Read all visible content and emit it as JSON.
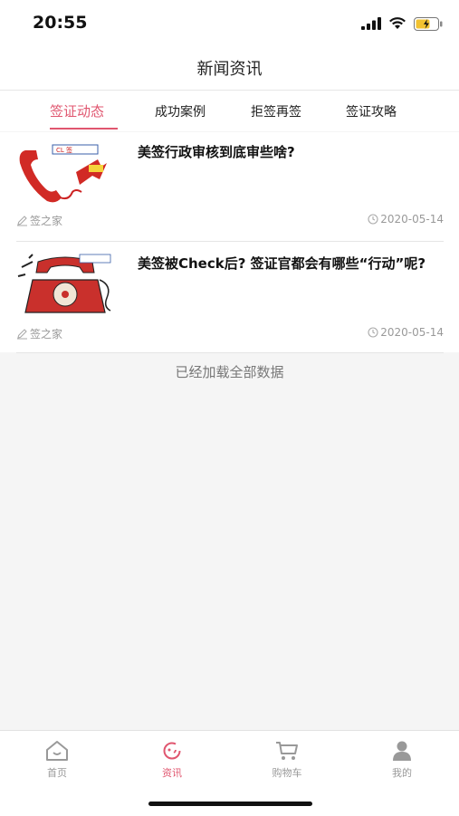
{
  "status_bar": {
    "time": "20:55"
  },
  "header": {
    "title": "新闻资讯"
  },
  "tabs": [
    {
      "label": "签证动态",
      "active": true
    },
    {
      "label": "成功案例",
      "active": false
    },
    {
      "label": "拒签再签",
      "active": false
    },
    {
      "label": "签证攻略",
      "active": false
    }
  ],
  "articles": [
    {
      "title": "美签行政审核到底审些啥?",
      "source": "签之家",
      "date": "2020-05-14",
      "thumb_icon": "red-phone-handset-image"
    },
    {
      "title": "美签被Check后? 签证官都会有哪些“行动”呢?",
      "source": "签之家",
      "date": "2020-05-14",
      "thumb_icon": "red-rotary-phone-image"
    }
  ],
  "list_footer": "已经加载全部数据",
  "tabbar": [
    {
      "label": "首页",
      "icon": "home-icon",
      "active": false
    },
    {
      "label": "资讯",
      "icon": "news-icon",
      "active": true
    },
    {
      "label": "购物车",
      "icon": "cart-icon",
      "active": false
    },
    {
      "label": "我的",
      "icon": "user-icon",
      "active": false
    }
  ],
  "colors": {
    "accent": "#e0566f",
    "muted": "#999999",
    "background": "#f5f5f5"
  }
}
